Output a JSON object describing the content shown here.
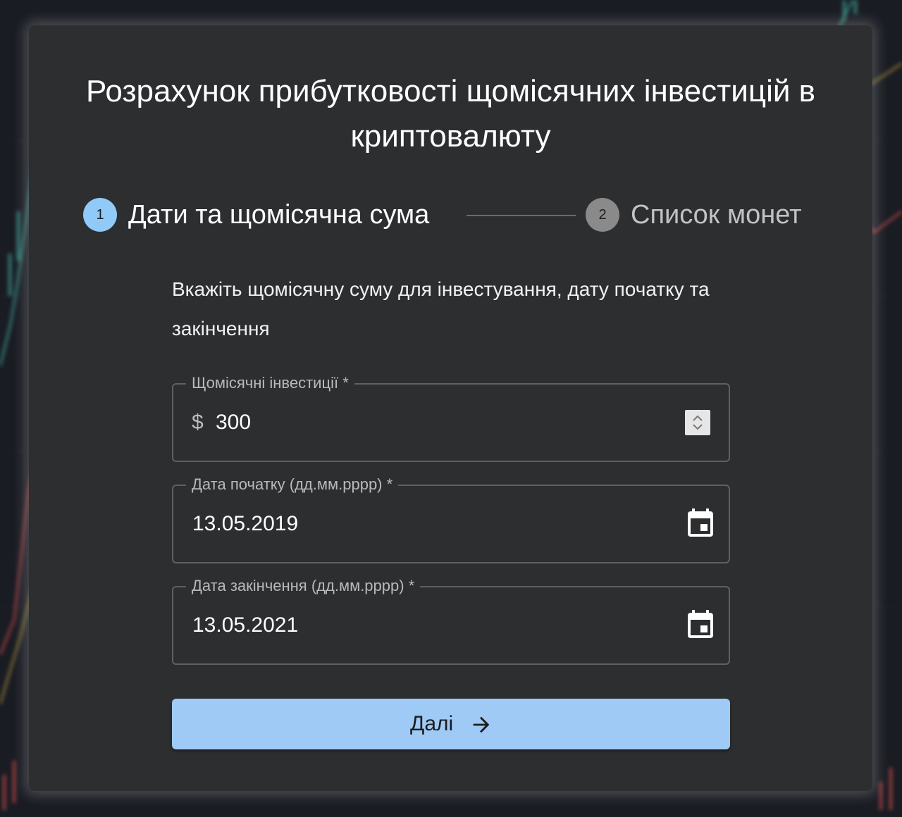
{
  "title": "Розрахунок прибутковості щомісячних інвестицій в криптовалюту",
  "stepper": {
    "steps": [
      {
        "number": "1",
        "label": "Дати та щомісячна сума",
        "state": "active"
      },
      {
        "number": "2",
        "label": "Список монет",
        "state": "inactive"
      }
    ]
  },
  "instructions": "Вкажіть щомісячну суму для інвестування, дату початку та закінчення",
  "fields": {
    "monthly": {
      "label": "Щомісячні інвестиції *",
      "prefix": "$",
      "value": "300"
    },
    "start_date": {
      "label": "Дата початку (дд.мм.рррр) *",
      "value": "13.05.2019"
    },
    "end_date": {
      "label": "Дата закінчення (дд.мм.рррр) *",
      "value": "13.05.2021"
    }
  },
  "next_button": {
    "label": "Далі"
  },
  "icons": {
    "spinner": "number-spinner-icon",
    "calendar": "calendar-icon",
    "arrow": "arrow-right-icon"
  },
  "colors": {
    "accent": "#90caf9",
    "card": "#2d2e30",
    "button": "#9ecaf5",
    "background": "#1a1c23"
  }
}
